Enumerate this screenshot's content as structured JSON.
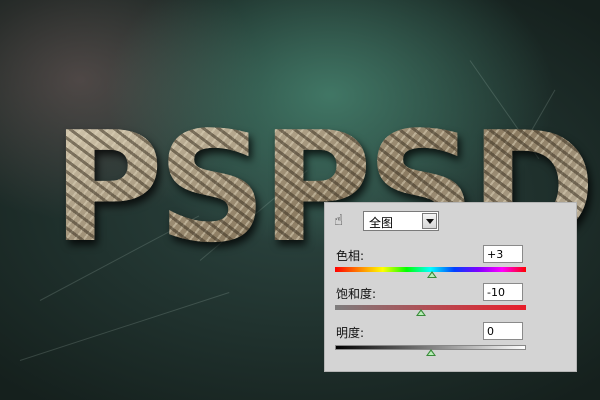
{
  "background_text": "PSPSD",
  "panel": {
    "scope_select": {
      "value": "全图"
    },
    "hue": {
      "label": "色相:",
      "value": "+3",
      "level": 0.51
    },
    "saturation": {
      "label": "饱和度:",
      "value": "-10",
      "level": 0.45
    },
    "lightness": {
      "label": "明度:",
      "value": "0",
      "level": 0.5
    }
  },
  "icons": {
    "hand": "hand-tool-icon",
    "dropdown": "chevron-down-icon"
  }
}
